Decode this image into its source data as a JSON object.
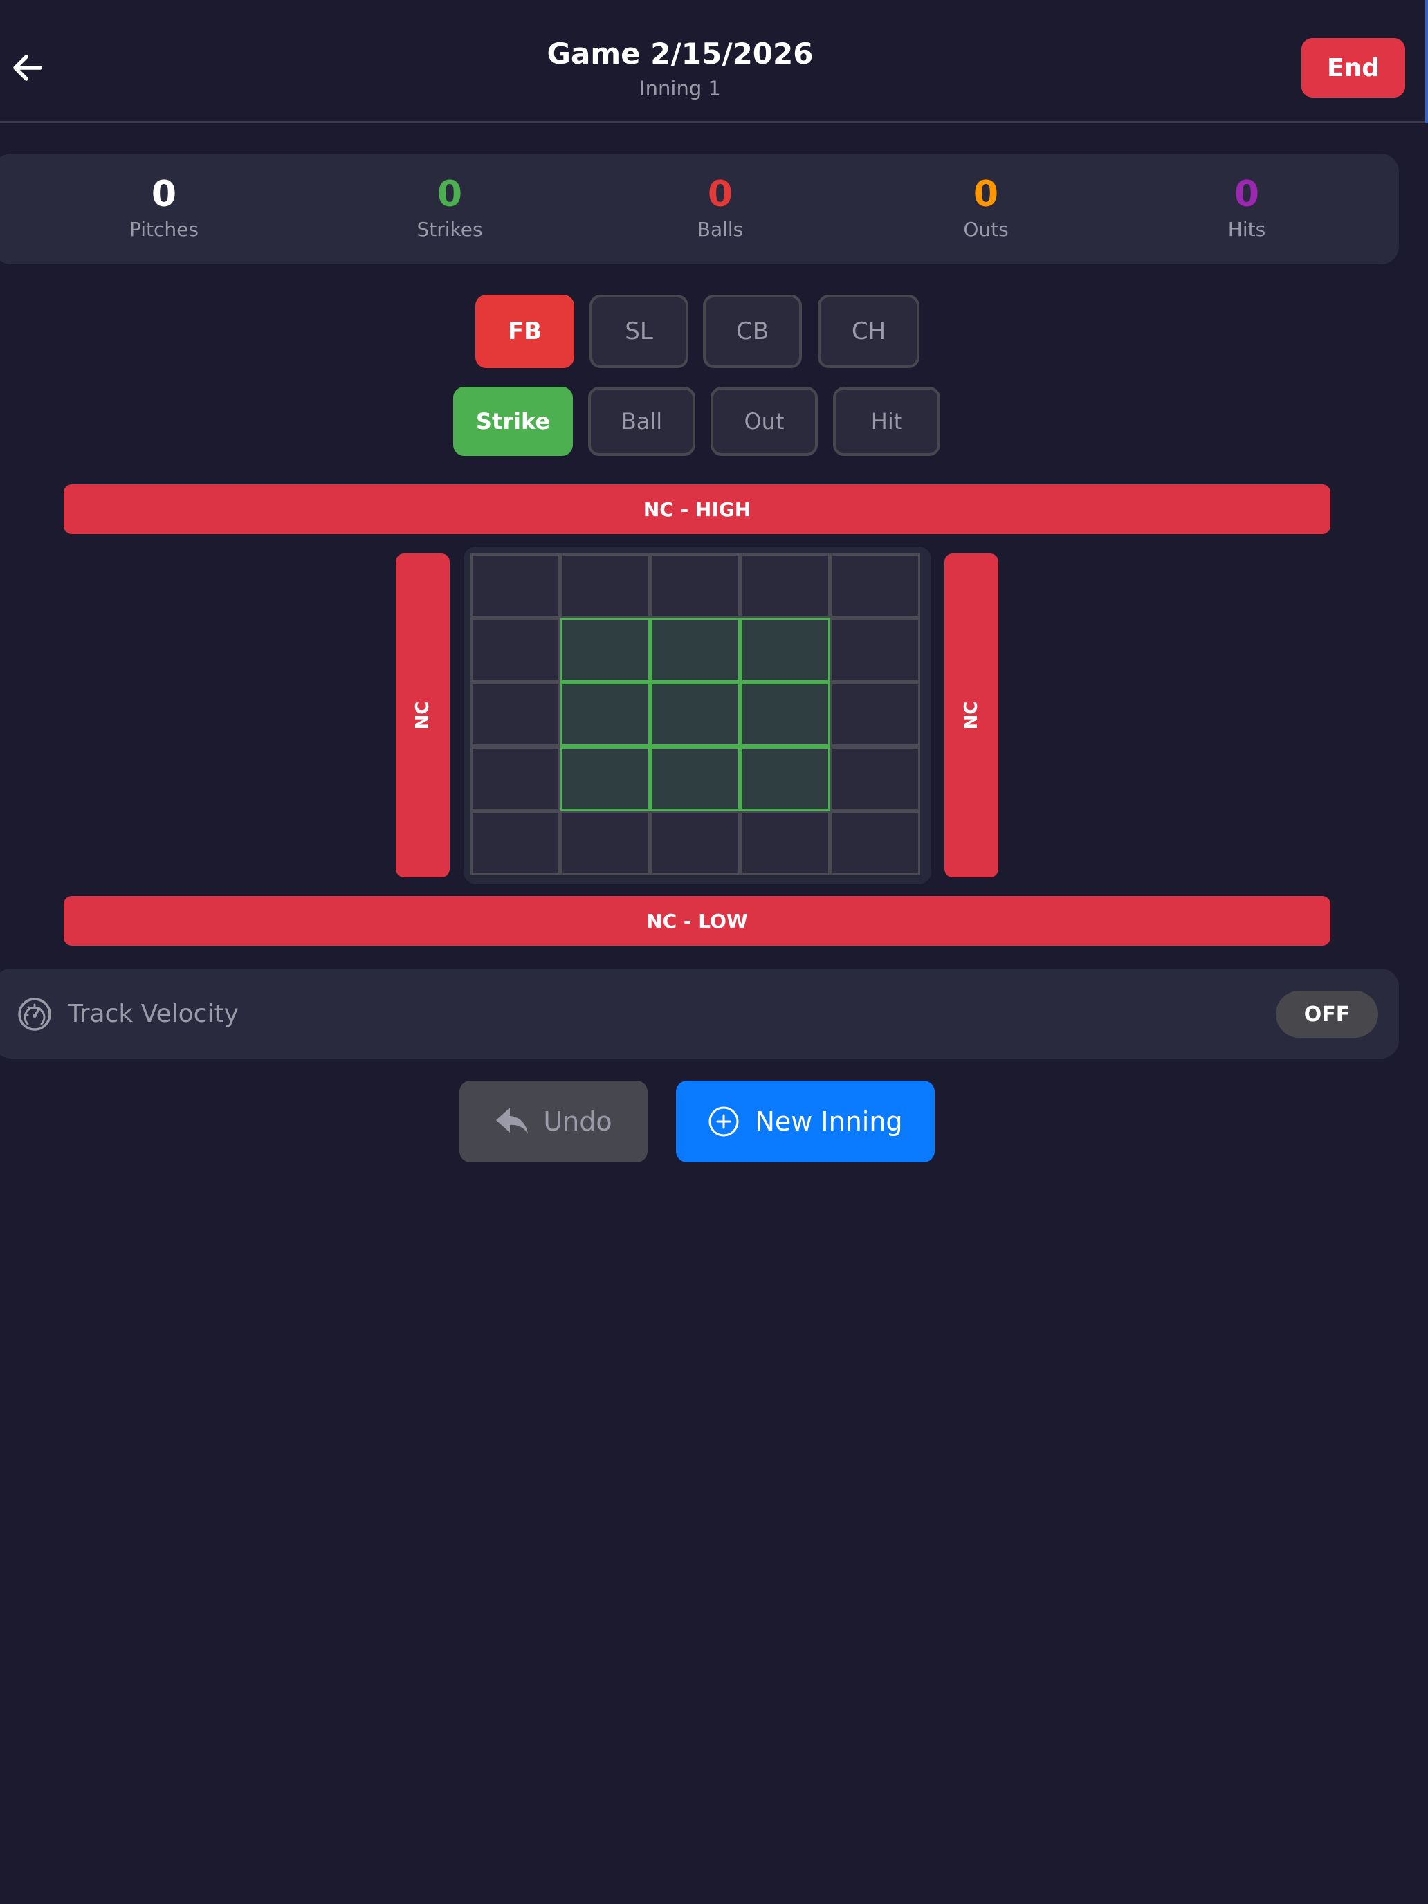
{
  "header": {
    "title": "Game 2/15/2026",
    "subtitle": "Inning 1",
    "end_label": "End",
    "back_icon": "arrow-left-icon"
  },
  "stats": [
    {
      "value": "0",
      "label": "Pitches",
      "color": "#ffffff"
    },
    {
      "value": "0",
      "label": "Strikes",
      "color": "#4caf50"
    },
    {
      "value": "0",
      "label": "Balls",
      "color": "#e53939"
    },
    {
      "value": "0",
      "label": "Outs",
      "color": "#ff9800"
    },
    {
      "value": "0",
      "label": "Hits",
      "color": "#9c27b0"
    }
  ],
  "pitch_types": [
    {
      "label": "FB",
      "selected": true
    },
    {
      "label": "SL",
      "selected": false
    },
    {
      "label": "CB",
      "selected": false
    },
    {
      "label": "CH",
      "selected": false
    }
  ],
  "results": [
    {
      "label": "Strike",
      "selected": true
    },
    {
      "label": "Ball",
      "selected": false
    },
    {
      "label": "Out",
      "selected": false
    },
    {
      "label": "Hit",
      "selected": false
    }
  ],
  "zones": {
    "high_label": "NC - HIGH",
    "low_label": "NC - LOW",
    "left_label": "NC",
    "right_label": "NC"
  },
  "velocity": {
    "label": "Track Velocity",
    "toggle_label": "OFF",
    "icon": "speedometer-icon"
  },
  "actions": {
    "undo_label": "Undo",
    "new_inning_label": "New Inning"
  },
  "colors": {
    "background": "#1b1a2e",
    "card": "#292a3d",
    "danger": "#dd3445",
    "strike_zone": "#4caf50",
    "primary": "#0a7aff"
  }
}
